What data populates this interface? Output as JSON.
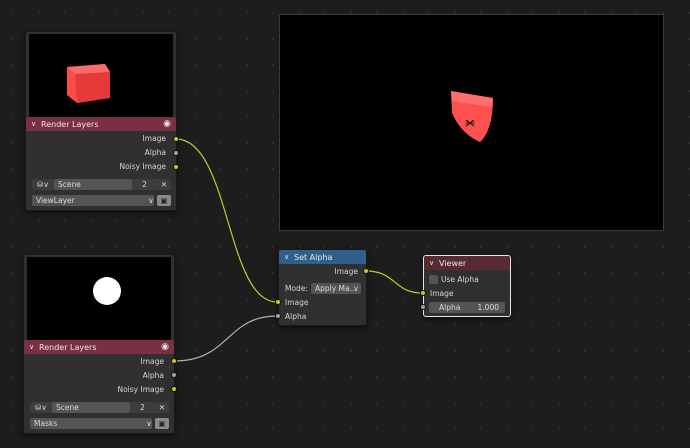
{
  "nodes": {
    "render_layers_1": {
      "title": "Render Layers",
      "outputs": [
        "Image",
        "Alpha",
        "Noisy Image"
      ],
      "scene": "Scene",
      "scene_users": "2",
      "layer": "ViewLayer"
    },
    "render_layers_2": {
      "title": "Render Layers",
      "outputs": [
        "Image",
        "Alpha",
        "Noisy Image"
      ],
      "scene": "Scene",
      "scene_users": "2",
      "layer": "Masks"
    },
    "set_alpha": {
      "title": "Set Alpha",
      "output": "Image",
      "mode_label": "Mode:",
      "mode_value": "Apply Ma...",
      "inputs": [
        "Image",
        "Alpha"
      ]
    },
    "viewer": {
      "title": "Viewer",
      "use_alpha_label": "Use Alpha",
      "use_alpha_checked": false,
      "input_image": "Image",
      "alpha_label": "Alpha",
      "alpha_value": "1.000"
    }
  },
  "colors": {
    "socket_image": "#c7c729",
    "socket_value": "#a1a1a1",
    "header_input": "#7a2f42",
    "header_converter": "#2f5f8a",
    "header_output": "#5a2a33",
    "preview_red": "#ff4a4a"
  },
  "icons": [
    "eye-icon",
    "scene-icon",
    "close-icon",
    "browse-icon",
    "chevron-down-icon",
    "checkbox-icon"
  ]
}
